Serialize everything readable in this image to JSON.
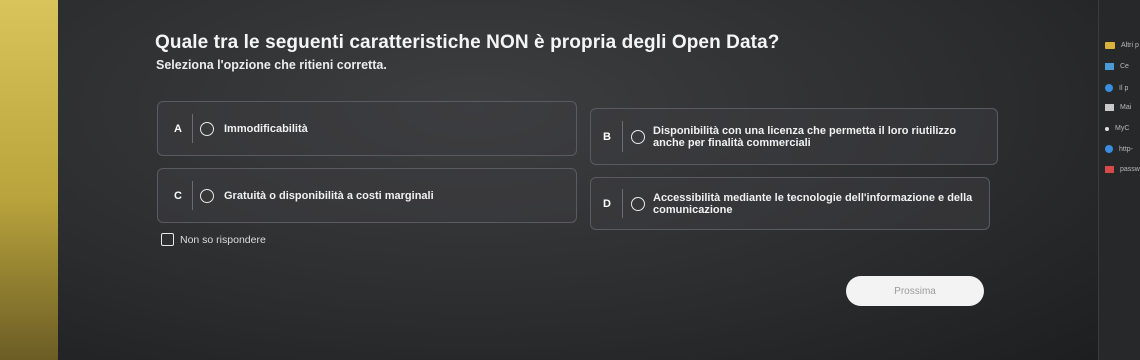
{
  "quiz": {
    "question": "Quale tra le seguenti caratteristiche NON è propria degli Open Data?",
    "instruction": "Seleziona l'opzione che ritieni corretta.",
    "options": [
      {
        "letter": "A",
        "text": "Immodificabilità"
      },
      {
        "letter": "B",
        "text": "Disponibilità con una licenza che permetta il loro riutilizzo anche per finalità commerciali"
      },
      {
        "letter": "C",
        "text": "Gratuità o disponibilità a costi marginali"
      },
      {
        "letter": "D",
        "text": "Accessibilità mediante le tecnologie dell'informazione e della comunicazione"
      }
    ],
    "dont_know_label": "Non so rispondere",
    "next_button_label": "Prossima"
  },
  "bookmarks_panel": {
    "items": [
      {
        "icon": "folder-icon",
        "label": "Altri p"
      },
      {
        "icon": "bookmark-icon",
        "label": "Ce"
      },
      {
        "icon": "circle-icon",
        "label": "Il p"
      },
      {
        "icon": "bookmark-icon",
        "label": "Mai"
      },
      {
        "icon": "dot-icon",
        "label": "MyC"
      },
      {
        "icon": "circle-icon",
        "label": "http-"
      },
      {
        "icon": "bookmark-icon",
        "label": "passw"
      }
    ]
  },
  "colors": {
    "background": "#2e2f31",
    "option_border": "#5a5b5e",
    "button_bg": "#f3f3f3",
    "button_text": "#9b9b9b",
    "accent_blue": "#3a8dde"
  }
}
